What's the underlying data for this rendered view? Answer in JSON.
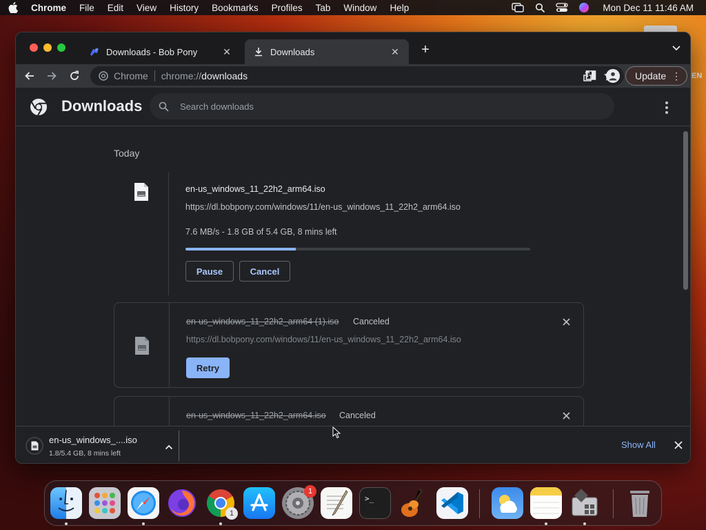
{
  "menubar": {
    "app_name": "Chrome",
    "menus": [
      "File",
      "Edit",
      "View",
      "History",
      "Bookmarks",
      "Profiles",
      "Tab",
      "Window",
      "Help"
    ],
    "clock": "Mon Dec 11  11:46 AM"
  },
  "tabs": [
    {
      "title": "Downloads - Bob Pony",
      "icon": "bob-pony-favicon",
      "active": false
    },
    {
      "title": "Downloads",
      "icon": "download-icon",
      "active": true
    }
  ],
  "omnibox": {
    "site_name": "Chrome",
    "scheme": "chrome://",
    "host": "downloads"
  },
  "toolbar": {
    "update_label": "Update"
  },
  "page": {
    "title": "Downloads",
    "search_placeholder": "Search downloads",
    "date_heading": "Today"
  },
  "downloads": [
    {
      "file_name": "en-us_windows_11_22h2_arm64.iso",
      "url": "https://dl.bobpony.com/windows/11/en-us_windows_11_22h2_arm64.iso",
      "progress_text": "7.6 MB/s - 1.8 GB of 5.4 GB, 8 mins left",
      "progress": 0.32,
      "pause_label": "Pause",
      "cancel_label": "Cancel"
    },
    {
      "file_name": "en-us_windows_11_22h2_arm64 (1).iso",
      "status": "Canceled",
      "url": "https://dl.bobpony.com/windows/11/en-us_windows_11_22h2_arm64.iso",
      "retry_label": "Retry"
    },
    {
      "file_name": "en-us_windows_11_22h2_arm64.iso",
      "status": "Canceled"
    }
  ],
  "shelf": {
    "file_name": "en-us_windows_....iso",
    "status": "1.8/5.4 GB, 8 mins left",
    "show_all_label": "Show All"
  },
  "dock": {
    "apps": [
      "Finder",
      "Launchpad",
      "Safari",
      "Firefox",
      "Google Chrome",
      "App Store",
      "System Settings",
      "TextEdit",
      "Terminal",
      "GarageBand",
      "Visual Studio Code",
      "Weather",
      "Notes",
      "Boot Camp Assistant",
      "Trash"
    ],
    "settings_badge": "1",
    "chrome_badge": "1"
  },
  "background_peek_text": "EN",
  "colors": {
    "accent": "#8ab4f8",
    "window_bg": "#202124",
    "toolbar_bg": "#35363a"
  }
}
